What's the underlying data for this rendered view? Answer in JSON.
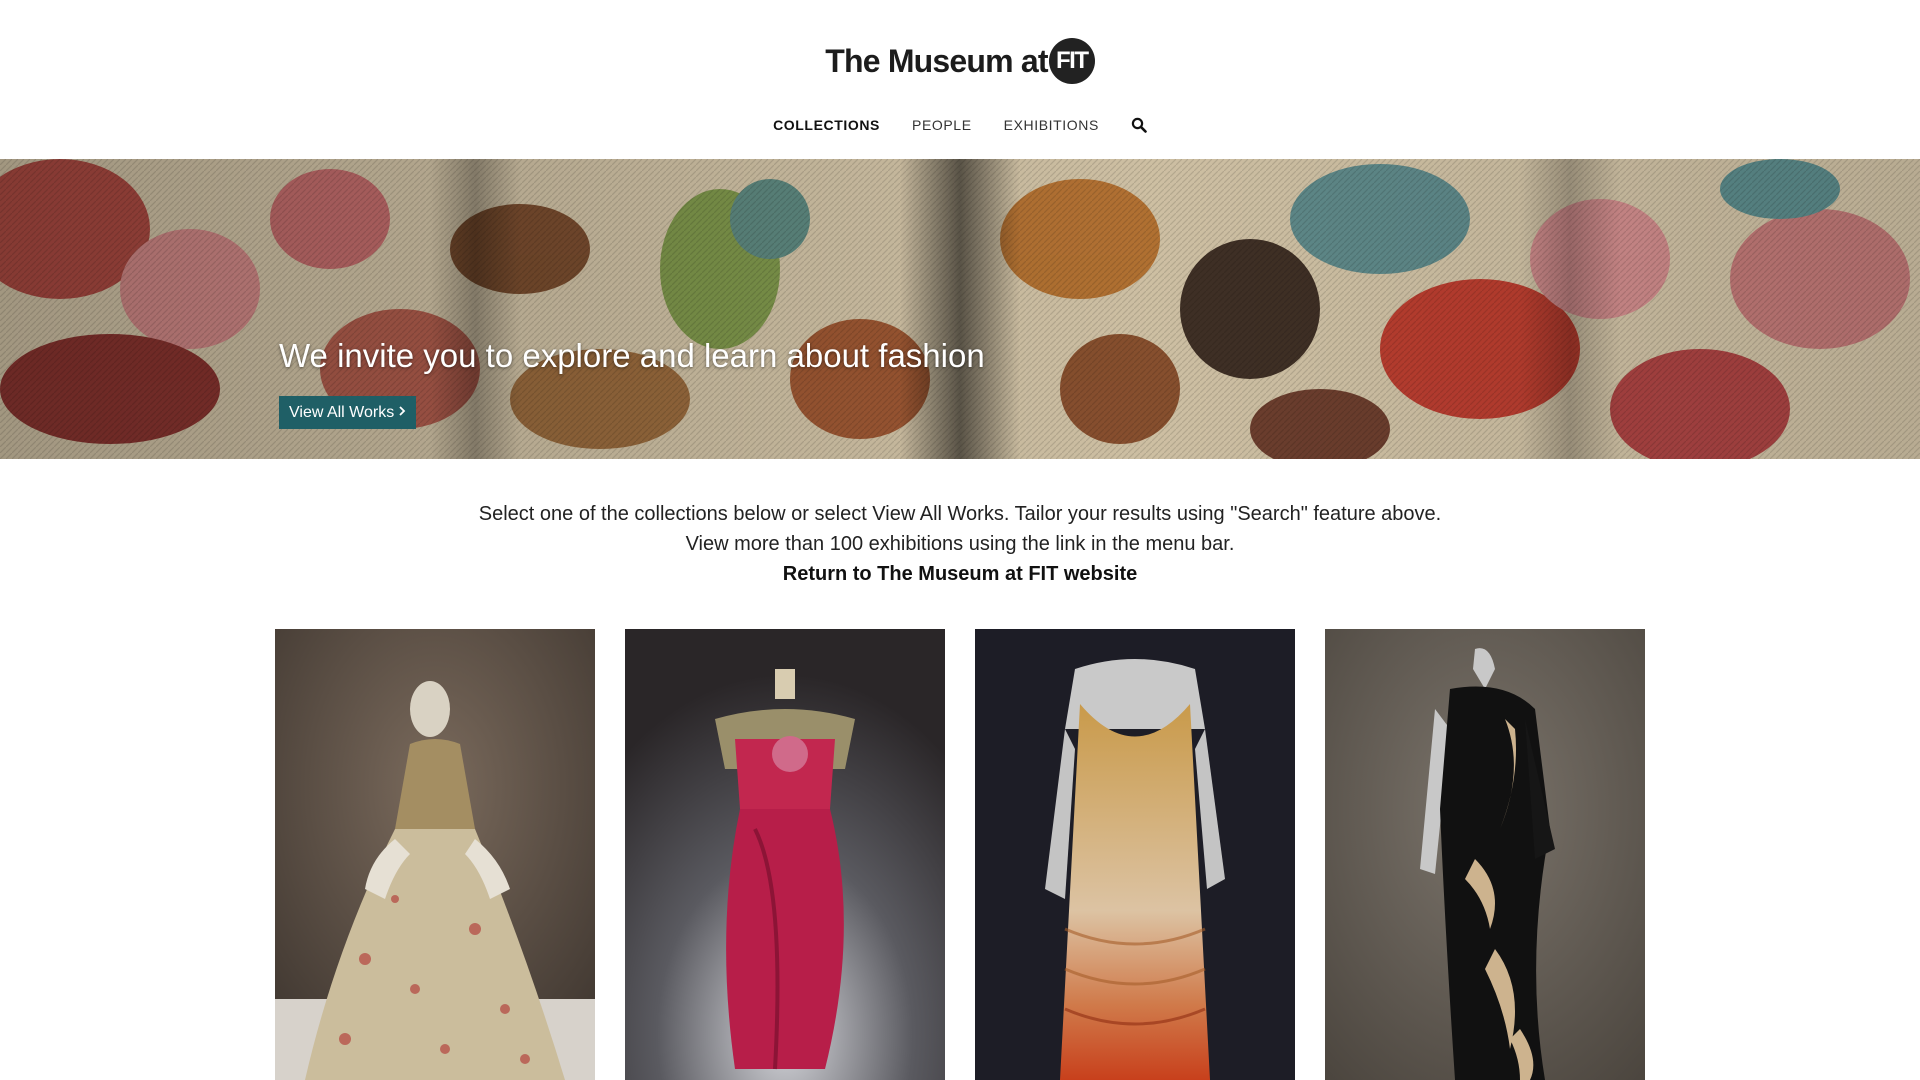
{
  "header": {
    "logo_text": "The Museum at",
    "logo_badge": "FIT",
    "nav": [
      {
        "label": "COLLECTIONS",
        "active": true
      },
      {
        "label": "PEOPLE",
        "active": false
      },
      {
        "label": "EXHIBITIONS",
        "active": false
      }
    ],
    "search_icon": "search-icon"
  },
  "hero": {
    "title": "We invite you to explore and learn about fashion",
    "button_label": "View All Works",
    "button_icon": "chevron-right-icon",
    "button_color": "#1f5f66"
  },
  "intro": {
    "line1": "Select one of the collections below or select View All Works. Tailor your results using \"Search\" feature above.",
    "line2": "View more than 100 exhibitions using the link in the menu bar.",
    "link": "Return to The Museum at FIT website"
  },
  "cards": [
    {
      "image": "floral-brocade-gown-photo"
    },
    {
      "image": "magenta-draped-gown-photo"
    },
    {
      "image": "beaded-flapper-dress-photo"
    },
    {
      "image": "black-evening-gown-photo"
    }
  ]
}
